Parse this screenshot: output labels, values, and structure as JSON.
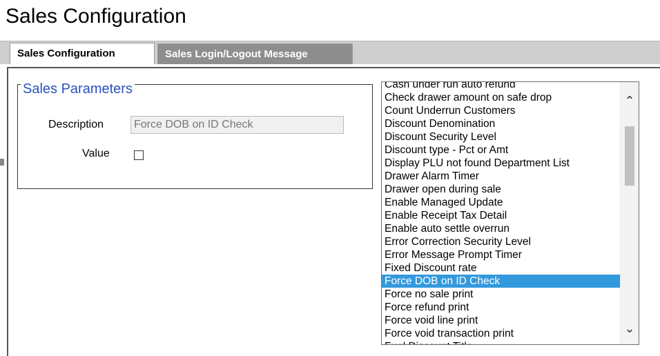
{
  "page": {
    "title": "Sales Configuration"
  },
  "tabs": [
    {
      "label": "Sales Configuration",
      "active": true
    },
    {
      "label": "Sales Login/Logout Message",
      "active": false
    }
  ],
  "params": {
    "legend": "Sales Parameters",
    "description_label": "Description",
    "description_value": "Force DOB on ID Check",
    "value_label": "Value",
    "value_checked": false
  },
  "list": {
    "selected_index": 15,
    "items": [
      "Cash under run auto refund",
      "Check drawer amount on safe drop",
      "Count Underrun Customers",
      "Discount Denomination",
      "Discount Security Level",
      "Discount type - Pct or Amt",
      "Display PLU not found Department List",
      "Drawer Alarm Timer",
      "Drawer open during sale",
      "Enable Managed Update",
      "Enable Receipt Tax Detail",
      "Enable auto settle overrun",
      "Error Correction Security Level",
      "Error Message Prompt Timer",
      "Fixed Discount rate",
      "Force DOB on ID Check",
      "Force no sale print",
      "Force refund print",
      "Force void line print",
      "Force void transaction print",
      "Fuel Discount Title"
    ]
  },
  "icons": {
    "scroll_up": "chevron-up-icon",
    "scroll_down": "chevron-down-icon"
  },
  "colors": {
    "accent": "#2a52be",
    "selection": "#3399dd",
    "inactive_tab": "#8e8e8e"
  }
}
